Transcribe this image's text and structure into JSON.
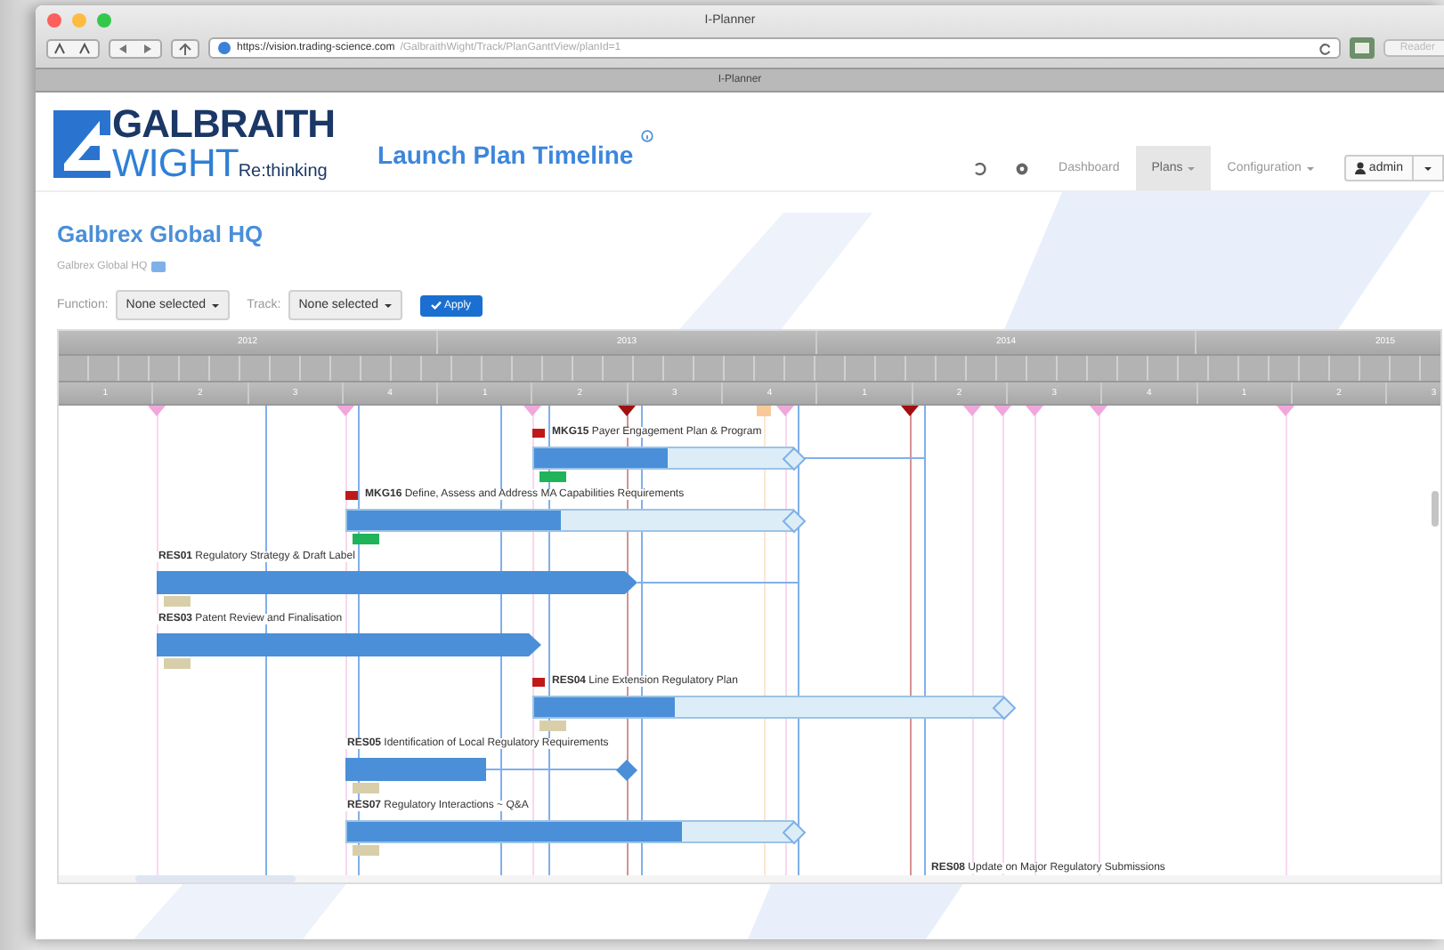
{
  "browser": {
    "title": "I-Planner",
    "url_host": "https://vision.trading-science.com",
    "url_path": "/GalbraithWight/Track/PlanGanttView/planId=1",
    "reader_label": "Reader",
    "tab_title": "I-Planner"
  },
  "logo": {
    "line1": "GALBRAITH",
    "line2": "WIGHT",
    "tagline": "Re:thinking"
  },
  "page_title": "Launch Plan Timeline",
  "nav": [
    {
      "label": "Dashboard",
      "selected": false,
      "dropdown": false
    },
    {
      "label": "Plans",
      "selected": true,
      "dropdown": true
    },
    {
      "label": "Configuration",
      "selected": false,
      "dropdown": true
    }
  ],
  "user": {
    "name": "admin"
  },
  "heading": "Galbrex Global HQ",
  "breadcrumb": "Galbrex Global HQ",
  "filters": [
    {
      "label": "Function:",
      "value": "None selected"
    },
    {
      "label": "Track:",
      "value": "None selected"
    }
  ],
  "apply_label": "Apply",
  "timeline": {
    "years": [
      "2012",
      "2013",
      "2014",
      "2015"
    ],
    "quarters": [
      "1",
      "2",
      "3",
      "4",
      "1",
      "2",
      "3",
      "4",
      "1",
      "2",
      "3",
      "4",
      "1",
      "2",
      "3"
    ]
  },
  "milestones": [
    {
      "kind": "triangle",
      "color": "#f0a8dc"
    },
    {
      "kind": "triangle",
      "color": "#f0a8dc"
    },
    {
      "kind": "triangle",
      "color": "#f0a8dc"
    },
    {
      "kind": "triangle",
      "color": "#a01010"
    },
    {
      "kind": "square",
      "color": "#f8c89a"
    },
    {
      "kind": "triangle",
      "color": "#f0a8dc"
    },
    {
      "kind": "triangle",
      "color": "#a01010"
    },
    {
      "kind": "triangle",
      "color": "#f0a8dc"
    },
    {
      "kind": "triangle",
      "color": "#f0a8dc"
    },
    {
      "kind": "triangle",
      "color": "#f0a8dc"
    },
    {
      "kind": "triangle",
      "color": "#f0a8dc"
    },
    {
      "kind": "triangle",
      "color": "#f0a8dc"
    }
  ],
  "tasks": [
    {
      "label": "**MKG15** Payer Engagement Plan & Program",
      "flagged": true,
      "level": 0.52,
      "kind": "open-diamond",
      "color": "#1fb35a"
    },
    {
      "label": "**MKG16** Define, Assess and Address MA Capabilities Requirements",
      "flagged": true,
      "level": 0.48,
      "kind": "open-diamond",
      "color": "#1fb35a"
    },
    {
      "label": "**RES01** Regulatory Strategy & Draft Label",
      "flagged": false,
      "kind": "arrow",
      "color": "#d8cfaa"
    },
    {
      "label": "**RES03** Patent Review and Finalisation",
      "flagged": false,
      "kind": "arrow",
      "color": "#d8cfaa"
    },
    {
      "label": "**RES04** Line Extension Regulatory Plan",
      "flagged": true,
      "level": 0.3,
      "kind": "open-diamond",
      "color": "#d8cfaa"
    },
    {
      "label": "**RES05** Identification of Local Regulatory Requirements",
      "flagged": false,
      "kind": "filled-diamond",
      "color": "#d8cfaa"
    },
    {
      "label": "**RES07** Regulatory Interactions ~ Q&A",
      "flagged": false,
      "level": 0.75,
      "kind": "open-diamond",
      "color": "#d8cfaa"
    },
    {
      "label": "**RES08** Update on Major Regulatory Submissions",
      "flagged": false
    }
  ]
}
